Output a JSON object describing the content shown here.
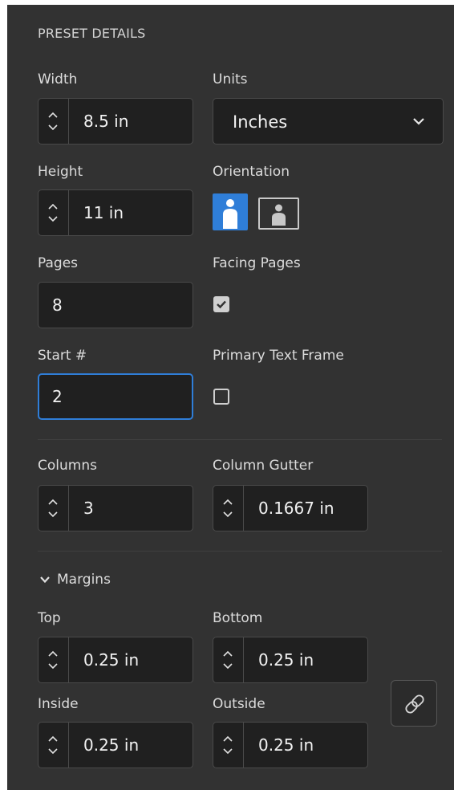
{
  "section_title": "PRESET DETAILS",
  "width": {
    "label": "Width",
    "value": "8.5 in"
  },
  "units": {
    "label": "Units",
    "value": "Inches"
  },
  "height": {
    "label": "Height",
    "value": "11 in"
  },
  "orientation": {
    "label": "Orientation",
    "selected": "portrait"
  },
  "pages": {
    "label": "Pages",
    "value": "8"
  },
  "facing_pages": {
    "label": "Facing Pages",
    "checked": true
  },
  "start_number": {
    "label": "Start #",
    "value": "2"
  },
  "primary_text_frame": {
    "label": "Primary Text Frame",
    "checked": false
  },
  "columns": {
    "label": "Columns",
    "value": "3"
  },
  "column_gutter": {
    "label": "Column Gutter",
    "value": "0.1667 in"
  },
  "margins": {
    "label": "Margins",
    "top": {
      "label": "Top",
      "value": "0.25 in"
    },
    "bottom": {
      "label": "Bottom",
      "value": "0.25 in"
    },
    "inside": {
      "label": "Inside",
      "value": "0.25 in"
    },
    "outside": {
      "label": "Outside",
      "value": "0.25 in"
    }
  },
  "colors": {
    "panel": "#323232",
    "field": "#202020",
    "accent": "#2f7ed8"
  }
}
